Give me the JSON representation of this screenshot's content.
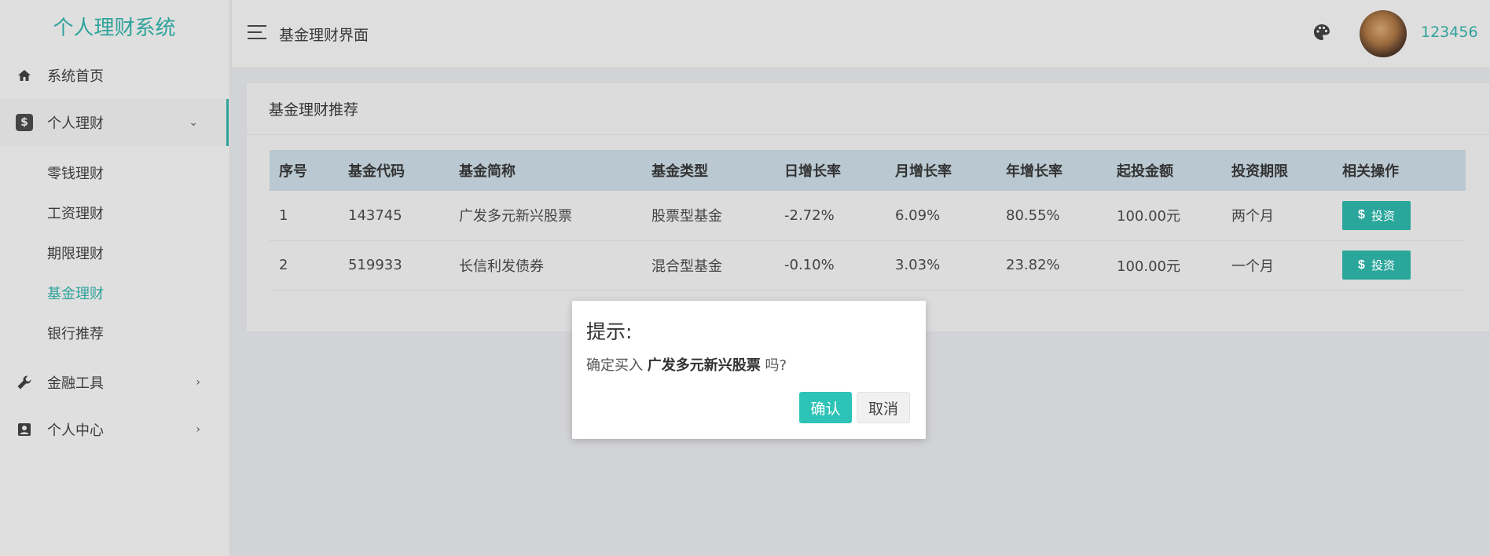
{
  "brand": "个人理财系统",
  "sidebar": {
    "items": [
      {
        "label": "系统首页",
        "icon": "home-icon"
      },
      {
        "label": "个人理财",
        "icon": "dollar-icon"
      },
      {
        "label": "金融工具",
        "icon": "wrench-icon"
      },
      {
        "label": "个人中心",
        "icon": "user-card-icon"
      }
    ],
    "submenu": [
      "零钱理财",
      "工资理财",
      "期限理财",
      "基金理财",
      "银行推荐"
    ]
  },
  "header": {
    "title": "基金理财界面",
    "username": "123456"
  },
  "card": {
    "title": "基金理财推荐",
    "columns": [
      "序号",
      "基金代码",
      "基金简称",
      "基金类型",
      "日增长率",
      "月增长率",
      "年增长率",
      "起投金额",
      "投资期限",
      "相关操作"
    ],
    "rows": [
      {
        "no": "1",
        "code": "143745",
        "name": "广发多元新兴股票",
        "type": "股票型基金",
        "daily": "-2.72%",
        "monthly": "6.09%",
        "yearly": "80.55%",
        "min": "100.00元",
        "term": "两个月",
        "action": "投资"
      },
      {
        "no": "2",
        "code": "519933",
        "name": "长信利发债券",
        "type": "混合型基金",
        "daily": "-0.10%",
        "monthly": "3.03%",
        "yearly": "23.82%",
        "min": "100.00元",
        "term": "一个月",
        "action": "投资"
      }
    ]
  },
  "dialog": {
    "title": "提示:",
    "msg_prefix": "确定买入",
    "msg_fund": "广发多元新兴股票",
    "msg_suffix": "吗?",
    "confirm": "确认",
    "cancel": "取消"
  },
  "colors": {
    "accent": "#2fa39b",
    "confirm": "#2dc3b6",
    "table_header": "#b9c8d1"
  }
}
